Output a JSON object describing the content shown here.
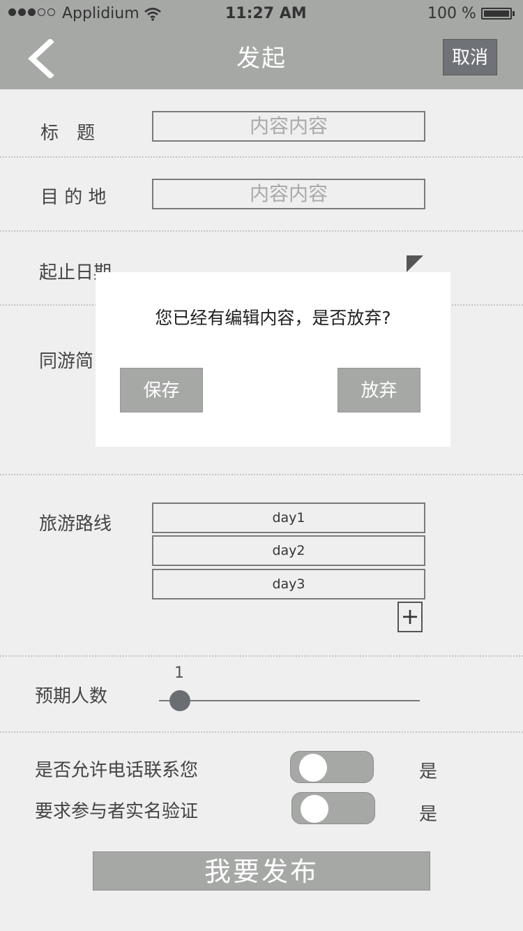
{
  "status_bar": {
    "carrier": "Applidium",
    "time": "11:27 AM",
    "battery": "100 %"
  },
  "nav": {
    "title": "发起",
    "cancel_label": "取消"
  },
  "form": {
    "title_label": "标　题",
    "title_placeholder": "内容内容",
    "destination_label": "目 的 地",
    "destination_placeholder": "内容内容",
    "dates_label": "起止日期",
    "companion_label": "同游简",
    "route_label": "旅游路线",
    "route_days": [
      "day1",
      "day2",
      "day3"
    ],
    "add_day_label": "+",
    "expected_people_label": "预期人数",
    "expected_people_value": "1",
    "allow_phone_label": "是否允许电话联系您",
    "allow_phone_state": "是",
    "require_realname_label": "要求参与者实名验证",
    "require_realname_state": "是",
    "publish_label": "我要发布"
  },
  "dialog": {
    "message": "您已经有编辑内容，是否放弃?",
    "save_label": "保存",
    "discard_label": "放弃"
  },
  "colors": {
    "bar": "#a6a8a6",
    "background": "#efefef",
    "cancel_button": "#6f7277",
    "slider_thumb": "#6a6d72"
  },
  "icons": [
    "back-chevron-icon",
    "wifi-icon",
    "battery-icon",
    "signal-dots-icon",
    "plus-icon"
  ]
}
